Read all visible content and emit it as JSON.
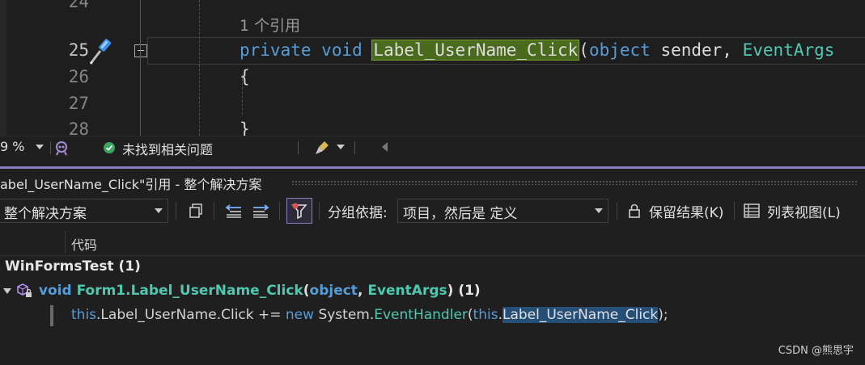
{
  "editor": {
    "line_numbers": [
      "24",
      "25",
      "26",
      "27",
      "28"
    ],
    "codelens": "1 个引用",
    "line25": {
      "kw1": "private",
      "kw2": "void",
      "method": "Label_UserName_Click",
      "paren": "(",
      "kw3": "object",
      "param1": "sender,",
      "type2": "EventArgs"
    },
    "line26": "{",
    "line28": "}"
  },
  "statusbar": {
    "zoom": "9 %",
    "issues": "未找到相关问题"
  },
  "references_window": {
    "title": "abel_UserName_Click\"引用 - 整个解决方案",
    "scope_combo": "整个解决方案",
    "group_by_label": "分组依据:",
    "group_by_value": "项目，然后是 定义",
    "keep_results": "保留结果(K)",
    "list_view": "列表视图(L)",
    "column_code": "代码",
    "project": {
      "name": "WinFormsTest",
      "count": "(1)"
    },
    "symbol": {
      "kw_void": "void",
      "name": "Form1.Label_UserName_Click",
      "open": "(",
      "kw_object": "object",
      "comma": ",",
      "type": "EventArgs",
      "close": ")",
      "count": "(1)"
    },
    "reference": {
      "this1": "this",
      "mid1": ".Label_UserName.Click += ",
      "new": "new",
      "sys": " System.",
      "handler": "EventHandler",
      "open": "(",
      "this2": "this",
      "dot": ".",
      "selected": "Label_UserName_Click",
      "end": ");"
    }
  },
  "watermark": "CSDN @熊思宇",
  "colors": {
    "editor_bg": "#1e1e1e",
    "keyword": "#569cd6",
    "type": "#4ec9b0",
    "highlight": "#4a6b1e",
    "accent": "#8b7cc2",
    "selection": "#264f78"
  }
}
